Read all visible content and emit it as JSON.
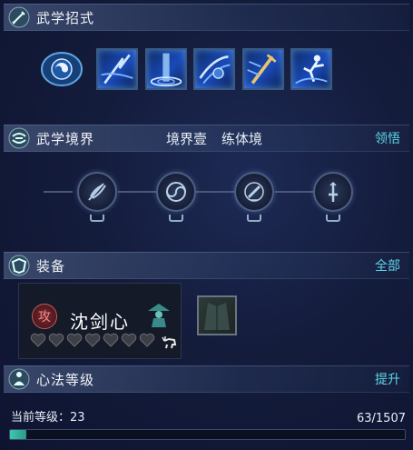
{
  "sections": {
    "martial_moves": {
      "title": "武学招式"
    },
    "martial_realm": {
      "title": "武学境界",
      "realm_stage": "境界壹",
      "realm_name": "练体境",
      "action": "领悟"
    },
    "equipment": {
      "title": "装备",
      "action": "全部"
    },
    "mental_level": {
      "title": "心法等级",
      "action": "提升"
    }
  },
  "skills": [
    {
      "icon": "swirl-scroll-icon"
    },
    {
      "icon": "lightning-slash-icon"
    },
    {
      "icon": "water-pillar-icon"
    },
    {
      "icon": "wind-strike-icon"
    },
    {
      "icon": "golden-sword-icon"
    },
    {
      "icon": "leaping-figure-icon"
    }
  ],
  "realm_nodes": [
    {
      "icon": "feather-icon"
    },
    {
      "icon": "yin-yang-icon"
    },
    {
      "icon": "brush-icon"
    },
    {
      "icon": "sword-icon"
    }
  ],
  "equipment": {
    "badge": "攻",
    "name": "沈剑心",
    "hearts_total": 7,
    "hearts_filled": 0
  },
  "level": {
    "label": "当前等级：23",
    "progress_text": "63/1507",
    "current": 63,
    "max": 1507
  },
  "colors": {
    "accent": "#5fd6e6",
    "badge": "#e05a5a",
    "progress": "#3fc6b0"
  }
}
